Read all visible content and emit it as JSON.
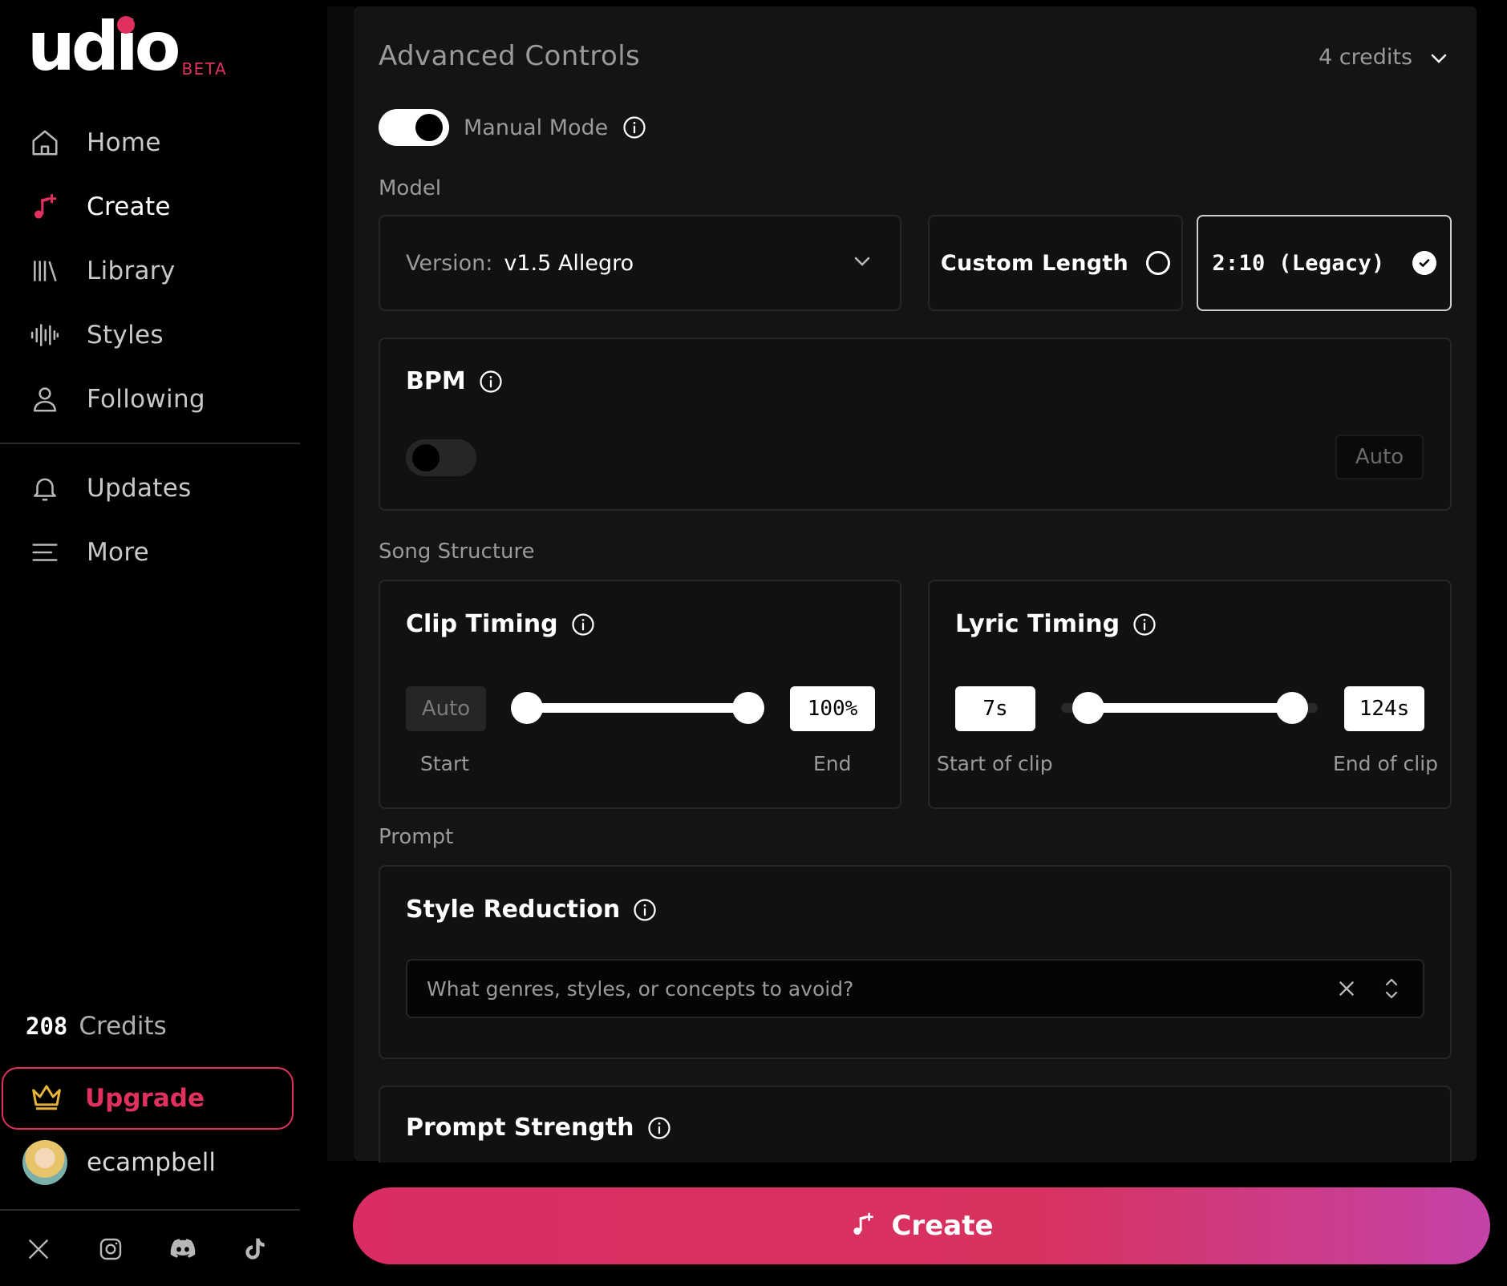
{
  "app": {
    "logo_text": "udio",
    "logo_badge": "BETA",
    "brand_color": "#e0305e"
  },
  "sidebar": {
    "nav": [
      {
        "label": "Home",
        "icon": "home-icon",
        "active": false
      },
      {
        "label": "Create",
        "icon": "music-plus-icon",
        "active": true
      },
      {
        "label": "Library",
        "icon": "library-icon",
        "active": false
      },
      {
        "label": "Styles",
        "icon": "waveform-icon",
        "active": false
      },
      {
        "label": "Following",
        "icon": "user-icon",
        "active": false
      }
    ],
    "secondary": [
      {
        "label": "Updates",
        "icon": "bell-icon"
      },
      {
        "label": "More",
        "icon": "menu-icon"
      }
    ],
    "credits_count": "208",
    "credits_label": "Credits",
    "upgrade_label": "Upgrade",
    "username": "ecampbell",
    "social_icons": [
      "x-icon",
      "instagram-icon",
      "discord-icon",
      "tiktok-icon"
    ]
  },
  "advanced": {
    "title": "Advanced Controls",
    "credits_cost": "4 credits",
    "manual_mode_label": "Manual Mode",
    "manual_mode_on": true,
    "model_label": "Model",
    "version_key": "Version:",
    "version_value": "v1.5 Allegro",
    "custom_length_label": "Custom Length",
    "legacy_label": "2:10 (Legacy)",
    "legacy_selected": true,
    "bpm": {
      "title": "BPM",
      "enabled": false,
      "value_placeholder": "Auto"
    },
    "song_structure_label": "Song Structure",
    "clip_timing": {
      "title": "Clip Timing",
      "start_value": "Auto",
      "end_value": "100%",
      "start_label": "Start",
      "end_label": "End"
    },
    "lyric_timing": {
      "title": "Lyric Timing",
      "start_value": "7s",
      "end_value": "124s",
      "start_label": "Start of clip",
      "end_label": "End of clip"
    },
    "prompt_label": "Prompt",
    "style_reduction": {
      "title": "Style Reduction",
      "placeholder": "What genres, styles, or concepts to avoid?"
    },
    "prompt_strength": {
      "title": "Prompt Strength"
    }
  },
  "create_button_label": "Create"
}
